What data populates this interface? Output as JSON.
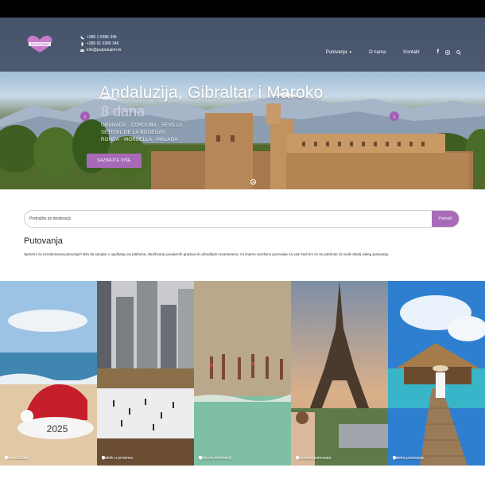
{
  "header": {
    "logo_text": "PUT POTNIKI",
    "contacts": [
      {
        "icon": "phone-icon",
        "text": "+385 1 6386 346"
      },
      {
        "icon": "mobile-icon",
        "text": "+385 91 6386 346"
      },
      {
        "icon": "mail-icon",
        "text": "info@putputujem.hr"
      }
    ],
    "nav": {
      "putovanja": "Putovanja",
      "o_nama": "O nama",
      "kontakt": "Kontakt"
    },
    "social_icons": [
      "facebook-icon",
      "instagram-icon",
      "search-icon"
    ]
  },
  "hero": {
    "title": "Andaluzija, Gibraltar i Maroko",
    "subtitle": "8 dana",
    "lines": [
      "GRANADA · CORDOBA · SEVILLA",
      "SETENIL DE LA BODEGAS",
      "RONDA · MORBELLA · MALAGA"
    ],
    "button": "SAZNAJTE VIŠE"
  },
  "search": {
    "placeholder": "Pretražite po destinaciji",
    "button": "Pretraži"
  },
  "section": {
    "title": "Putovanja",
    "description": "Spremni za nezaboravna putovanja? Bilo da sanjate o opuštanju na plažama, istraživanju povijesnih gradova ili uzbudljivim avanturama, mi imamo savršeno putovanje za vas! Naš tim će se pobrinuti za svaki detalj vašeg putovanja."
  },
  "cards": [
    {
      "label": "Nova Godina",
      "badge": "2025"
    },
    {
      "label": "Fašnik u prosincu"
    },
    {
      "label": "Ljeto na destinaciji"
    },
    {
      "label": "Europska putovanja"
    },
    {
      "label": "Daleka putovanja"
    }
  ],
  "colors": {
    "accent": "#a86ab9",
    "topbar": "#343c52",
    "text": "#222222"
  }
}
